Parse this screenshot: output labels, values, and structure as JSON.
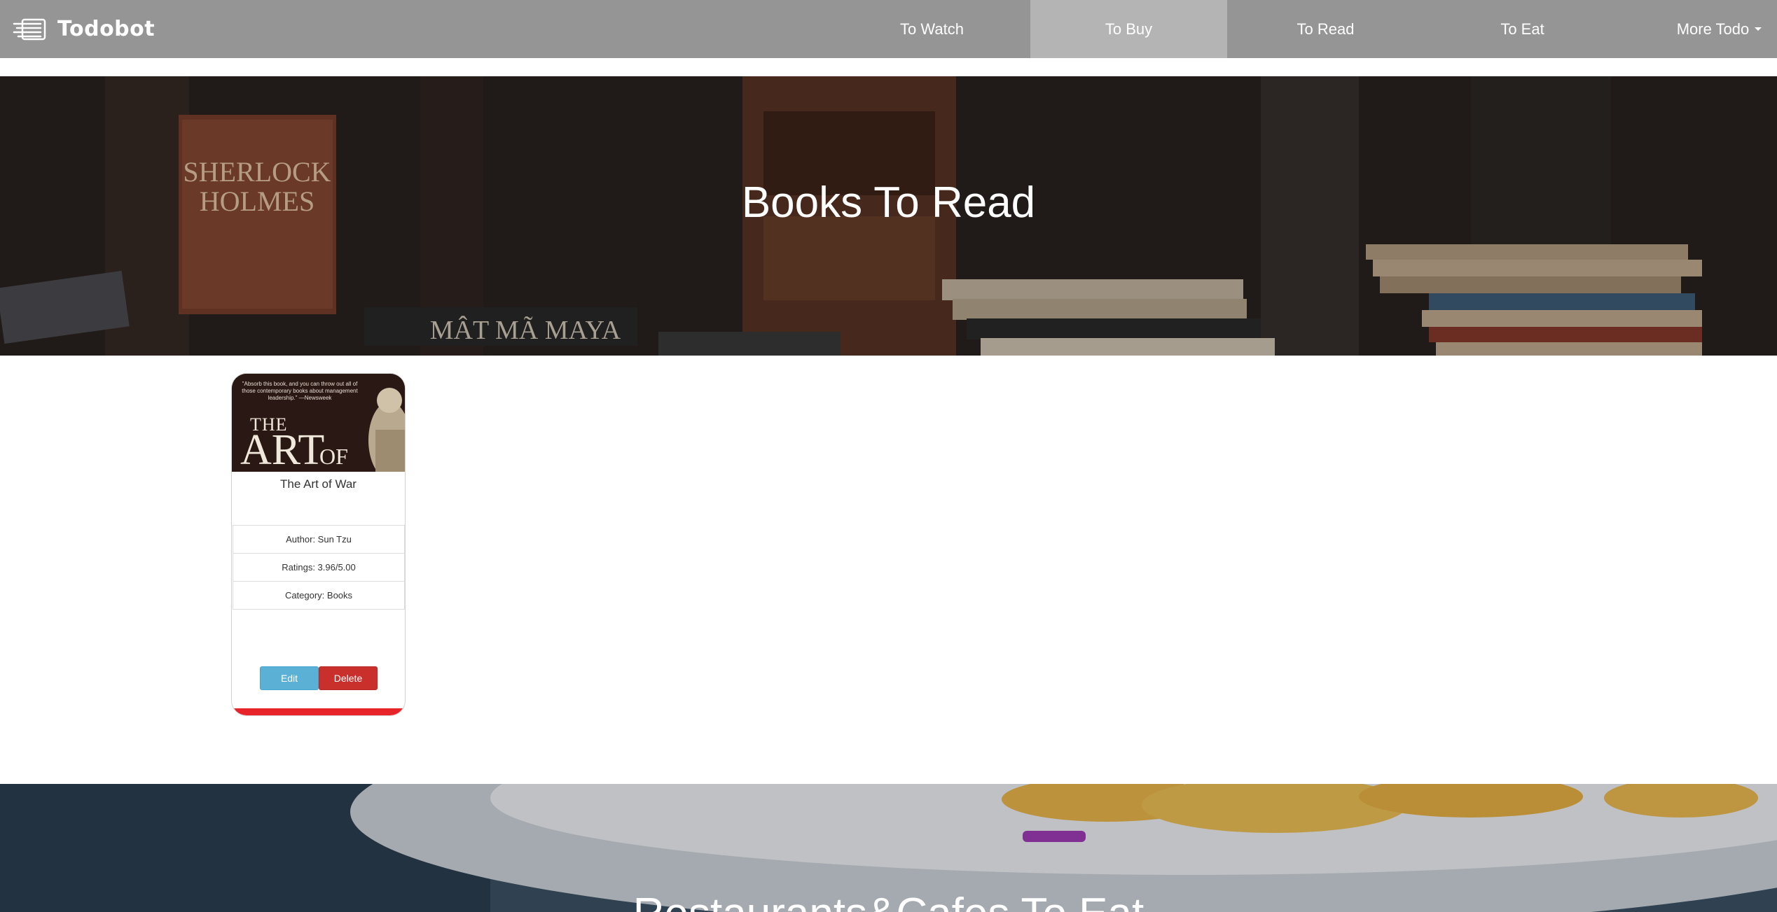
{
  "brand": {
    "name": "Todobot",
    "icon": "list-icon"
  },
  "nav": {
    "items": [
      {
        "label": "To Watch",
        "active": false
      },
      {
        "label": "To Buy",
        "active": true
      },
      {
        "label": "To Read",
        "active": false
      },
      {
        "label": "To Eat",
        "active": false
      },
      {
        "label": "More Todo",
        "active": false,
        "dropdown": true
      }
    ]
  },
  "hero_books": {
    "title": "Books To Read"
  },
  "card": {
    "image": {
      "quote": "\"Absorb this book, and you can throw out all of those contemporary books about management leadership.\" —Newsweek",
      "cover_the": "THE",
      "cover_art": "ART",
      "cover_of": "OF"
    },
    "title": "The Art of War",
    "author": "Author: Sun Tzu",
    "ratings": "Ratings: 3.96/5.00",
    "category": "Category: Books",
    "edit_label": "Edit",
    "delete_label": "Delete"
  },
  "hero_food": {
    "title": "Restaurants&Cafes To Eat"
  },
  "colors": {
    "navbar": "#959595",
    "nav_active": "#b4b4b4",
    "edit_button": "#5bb0d6",
    "delete_button": "#c9302c",
    "card_accent": "#e8242b"
  }
}
